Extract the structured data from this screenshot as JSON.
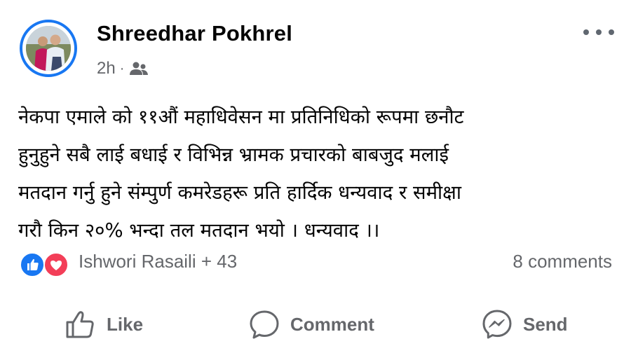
{
  "post": {
    "author": "Shreedhar Pokhrel",
    "time": "2h",
    "separator": "·",
    "audience_icon": "friends-icon",
    "more_icon": "more-options-icon",
    "text": "नेकपा एमाले को ११औं महाधिवेसन मा प्रतिनिधिको रूपमा छनौट\nहुनुहुने सबै लाई बधाई र विभिन्न भ्रामक प्रचारको बाबजुद मलाई\nमतदान गर्नु हुने संम्पुर्ण कमरेडहरू प्रति हार्दिक धन्यवाद र समीक्षा\nगरौ किन २०% भन्दा तल मतदान भयो । धन्यवाद ।।"
  },
  "reactions": {
    "icons": [
      "like-reaction-icon",
      "love-reaction-icon"
    ],
    "names": "Ishwori Rasaili + 43",
    "comments": "8 comments"
  },
  "actions": {
    "like": "Like",
    "comment": "Comment",
    "send": "Send"
  },
  "colors": {
    "accent": "#1877f2",
    "love": "#f33e58",
    "secondary_text": "#65676b"
  }
}
